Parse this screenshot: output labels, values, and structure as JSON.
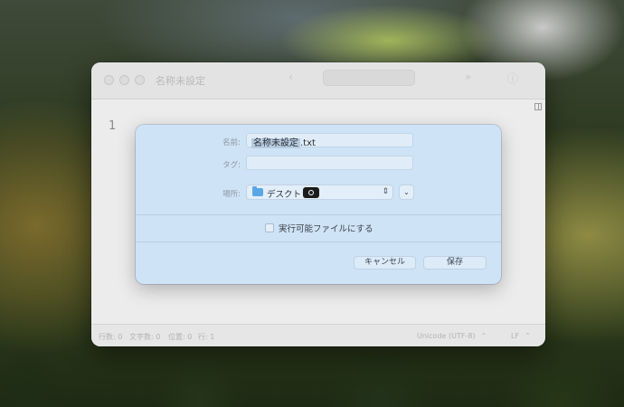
{
  "window": {
    "title": "名称未設定",
    "line_number": "1"
  },
  "status_bar": {
    "lines": "行数: 0",
    "chars": "文字数: 0",
    "position": "位置: 0",
    "row": "行: 1",
    "encoding": "Unicode (UTF-8)",
    "line_ending": "LF"
  },
  "save_dialog": {
    "name_label": "名前:",
    "name_value": "名称未設定.txt",
    "name_selected_part": "名称未設定",
    "name_extension": ".txt",
    "tags_label": "タグ:",
    "tags_value": "",
    "location_label": "場所:",
    "location_value": "デスクトップ",
    "executable_label": "実行可能ファイルにする",
    "executable_checked": false,
    "cancel_label": "キャンセル",
    "save_label": "保存"
  },
  "colors": {
    "sheet_bg": "#cfe3f6",
    "folder_icon": "#5aa7e6"
  }
}
